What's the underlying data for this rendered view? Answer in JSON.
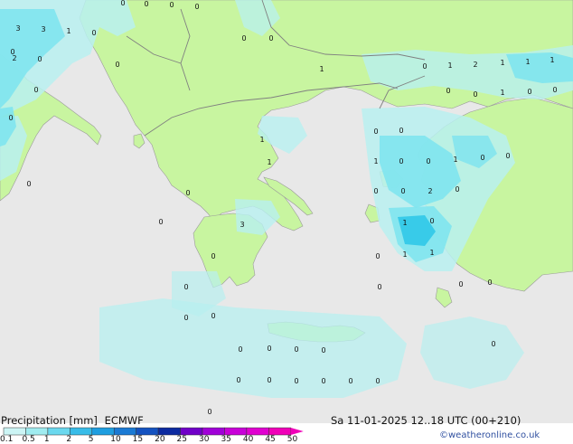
{
  "title": "Precipitation [mm]",
  "model": "ECMWF",
  "run_time": "Sa 11-01-2025 12..18 UTC (00+210)",
  "credit": "©weatheronline.co.uk",
  "colors": {
    "sea": "#e8e8e8",
    "land": "#c8f5a0",
    "precip_light": "#b8f0f0",
    "precip_mid": "#80e4ee",
    "precip_heavy": "#30c8e8",
    "border": "#808080"
  },
  "legend": {
    "ticks": [
      "0.1",
      "0.5",
      "1",
      "2",
      "5",
      "10",
      "15",
      "20",
      "25",
      "30",
      "35",
      "40",
      "45",
      "50"
    ],
    "colors": [
      "#ccf5f5",
      "#a0ecf0",
      "#6ad8ee",
      "#38bce8",
      "#1e9ee0",
      "#1a7ad4",
      "#1452c0",
      "#0c2aa0",
      "#7000c8",
      "#a000d8",
      "#c800d8",
      "#e000d0",
      "#f000b8"
    ]
  },
  "map_values": [
    {
      "text": "0"
    },
    {
      "text": "0"
    },
    {
      "text": "0"
    },
    {
      "text": "0"
    },
    {
      "text": "3"
    },
    {
      "text": "3"
    },
    {
      "text": "1"
    },
    {
      "text": "0"
    },
    {
      "text": "0"
    },
    {
      "text": "0"
    },
    {
      "text": "2"
    },
    {
      "text": "0"
    },
    {
      "text": "0"
    },
    {
      "text": "0"
    },
    {
      "text": "0"
    },
    {
      "text": "0"
    },
    {
      "text": "0"
    },
    {
      "text": "1"
    },
    {
      "text": "0"
    },
    {
      "text": "1"
    },
    {
      "text": "2"
    },
    {
      "text": "1"
    },
    {
      "text": "1"
    },
    {
      "text": "1"
    },
    {
      "text": "0"
    },
    {
      "text": "0"
    },
    {
      "text": "1"
    },
    {
      "text": "0"
    },
    {
      "text": "0"
    },
    {
      "text": "1"
    },
    {
      "text": "1"
    },
    {
      "text": "0"
    },
    {
      "text": "0"
    },
    {
      "text": "1"
    },
    {
      "text": "0"
    },
    {
      "text": "0"
    },
    {
      "text": "1"
    },
    {
      "text": "0"
    },
    {
      "text": "0"
    },
    {
      "text": "0"
    },
    {
      "text": "0"
    },
    {
      "text": "2"
    },
    {
      "text": "0"
    },
    {
      "text": "3"
    },
    {
      "text": "1"
    },
    {
      "text": "0"
    },
    {
      "text": "0"
    },
    {
      "text": "1"
    },
    {
      "text": "1"
    },
    {
      "text": "0"
    },
    {
      "text": "0"
    },
    {
      "text": "0"
    },
    {
      "text": "0"
    },
    {
      "text": "0"
    },
    {
      "text": "0"
    },
    {
      "text": "0"
    },
    {
      "text": "0"
    },
    {
      "text": "0"
    },
    {
      "text": "0"
    },
    {
      "text": "0"
    },
    {
      "text": "0"
    },
    {
      "text": "0"
    },
    {
      "text": "0"
    },
    {
      "text": "0"
    },
    {
      "text": "0"
    },
    {
      "text": "0"
    },
    {
      "text": "0"
    },
    {
      "text": "0"
    },
    {
      "text": "0"
    },
    {
      "text": "0"
    }
  ]
}
